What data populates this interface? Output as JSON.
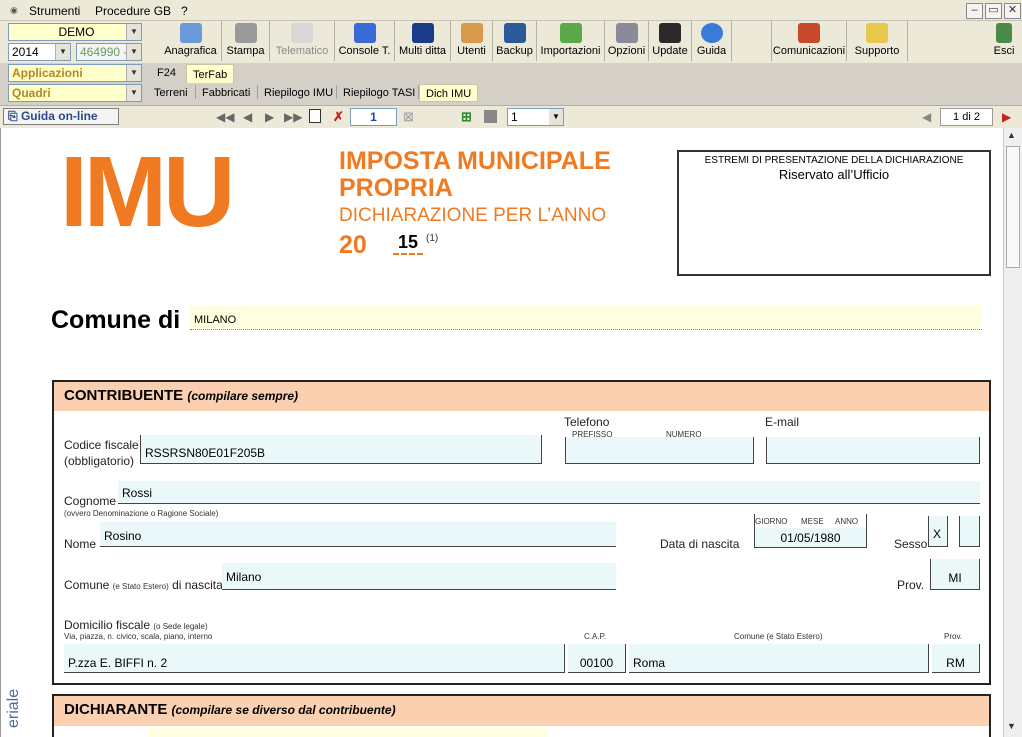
{
  "menu": {
    "items": [
      "Strumenti",
      "Procedure GB",
      "?"
    ]
  },
  "selectors": {
    "company": "DEMO",
    "year": "2014",
    "code": "464990 -",
    "applicazioni": "Applicazioni",
    "quadri": "Quadri"
  },
  "toolbar": {
    "buttons": [
      "Anagrafica",
      "Stampa",
      "Telematico",
      "Console T.",
      "Multi ditta",
      "Utenti",
      "Backup",
      "Importazioni",
      "Opzioni",
      "Update",
      "Guida",
      "Comunicazioni",
      "Supporto",
      "Esci"
    ]
  },
  "tabs": {
    "top": [
      "F24",
      "TerFab"
    ],
    "sub": [
      "Terreni",
      "Fabbricati",
      "Riepilogo IMU",
      "Riepilogo TASI",
      "Dich IMU"
    ]
  },
  "nav": {
    "guide": "Guida on-line",
    "page_input": "1",
    "page_select": "1",
    "page_indicator": "1 di 2"
  },
  "form": {
    "logo": "IMU",
    "title1": "IMPOSTA MUNICIPALE",
    "title2": "PROPRIA",
    "subtitle": "DICHIARAZIONE PER L’ANNO",
    "year_prefix": "20",
    "year_value": "15",
    "year_note": "(1)",
    "office_title": "ESTREMI DI PRESENTAZIONE DELLA DICHIARAZIONE",
    "office_sub": "Riservato all’Ufficio",
    "comune_label": "Comune di",
    "comune_value": "MILANO",
    "contribuente": {
      "title": "CONTRIBUENTE",
      "note": "(compilare sempre)",
      "telefono": "Telefono",
      "prefisso": "PREFISSO",
      "numero": "NUMERO",
      "email": "E-mail",
      "cf_label": "Codice fiscale",
      "cf_sub": "(obbligatorio)",
      "cf_value": "RSSRSN80E01F205B",
      "cognome_label": "Cognome",
      "cognome_sub": "(ovvero Denominazione o Ragione Sociale)",
      "cognome_value": "Rossi",
      "nome_label": "Nome",
      "nome_value": "Rosino",
      "nascita_label": "Data di nascita",
      "giorno": "GIORNO",
      "mese": "MESE",
      "anno": "ANNO",
      "nascita_value": "01/05/1980",
      "sesso_label": "Sesso",
      "sesso_value": "X",
      "comune_nascita_label": "Comune",
      "comune_nascita_small": "(e Stato Estero)",
      "comune_nascita_label2": "di nascita",
      "comune_nascita_value": "Milano",
      "prov_label": "Prov.",
      "prov_value": "MI",
      "domicilio_label": "Domicilio fiscale",
      "domicilio_small": "(o Sede legale)",
      "domicilio_sub": "Via, piazza, n. civico, scala, piano, interno",
      "cap_label": "C.A.P.",
      "comune2_label": "Comune (e Stato Estero)",
      "prov2_label": "Prov.",
      "via_value": "P.zza E. BIFFI n. 2",
      "cap_value": "00100",
      "comune2_value": "Roma",
      "prov2_value": "RM"
    },
    "dichiarante": {
      "title": "DICHIARANTE",
      "note": "(compilare se diverso dal contribuente)"
    },
    "side_text": "eriale"
  }
}
